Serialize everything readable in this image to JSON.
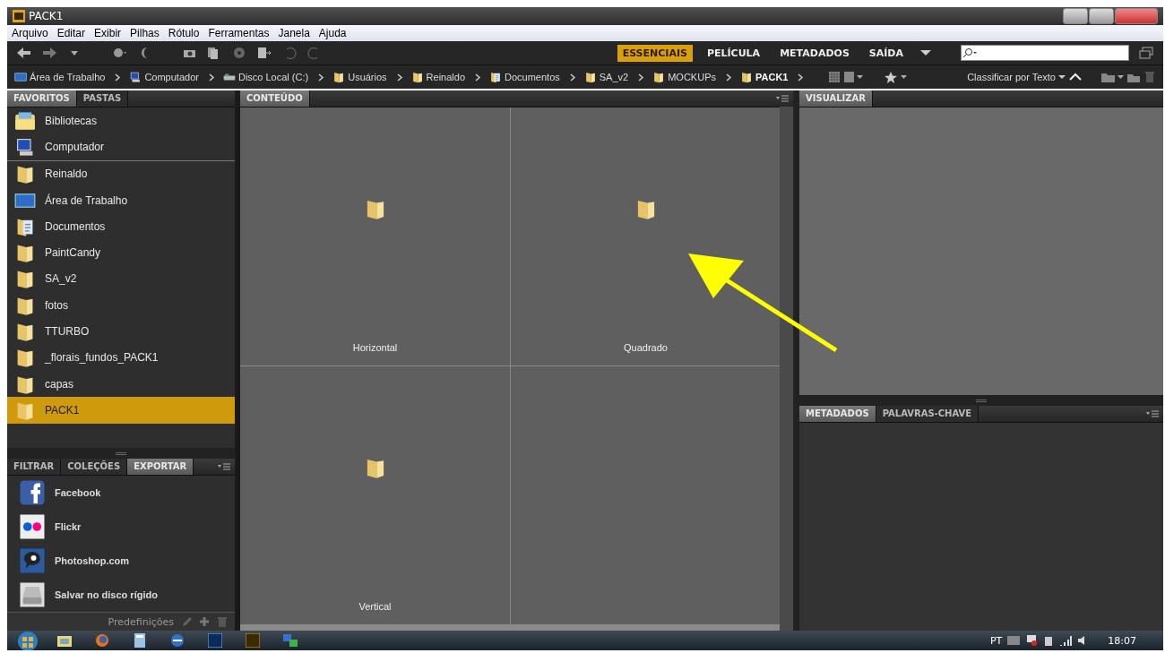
{
  "window": {
    "title": "PACK1"
  },
  "menu": [
    "Arquivo",
    "Editar",
    "Exibir",
    "Pilhas",
    "Rótulo",
    "Ferramentas",
    "Janela",
    "Ajuda"
  ],
  "workspaces": [
    {
      "label": "ESSENCIAIS",
      "selected": true
    },
    {
      "label": "PELÍCULA",
      "selected": false
    },
    {
      "label": "METADADOS",
      "selected": false
    },
    {
      "label": "SAÍDA",
      "selected": false
    }
  ],
  "breadcrumb": [
    {
      "label": "Área de Trabalho",
      "kind": "desktop",
      "current": false
    },
    {
      "label": "Computador",
      "kind": "computer",
      "current": false
    },
    {
      "label": "Disco Local (C:)",
      "kind": "drive",
      "current": false
    },
    {
      "label": "Usuários",
      "kind": "folder",
      "current": false
    },
    {
      "label": "Reinaldo",
      "kind": "folder",
      "current": false
    },
    {
      "label": "Documentos",
      "kind": "documents",
      "current": false
    },
    {
      "label": "SA_v2",
      "kind": "folder",
      "current": false
    },
    {
      "label": "MOCKUPs",
      "kind": "folder",
      "current": false
    },
    {
      "label": "PACK1",
      "kind": "folder",
      "current": true
    }
  ],
  "sort": {
    "label": "Classificar por Texto"
  },
  "favorites_panel": {
    "tabs": [
      {
        "label": "FAVORITOS",
        "selected": true
      },
      {
        "label": "PASTAS",
        "selected": false
      }
    ],
    "system_items": [
      {
        "label": "Bibliotecas",
        "kind": "library",
        "selected": false
      },
      {
        "label": "Computador",
        "kind": "computer",
        "selected": false
      }
    ],
    "items": [
      {
        "label": "Reinaldo",
        "kind": "folder",
        "selected": false
      },
      {
        "label": "Área de Trabalho",
        "kind": "desktop",
        "selected": false
      },
      {
        "label": "Documentos",
        "kind": "documents",
        "selected": false
      },
      {
        "label": "PaintCandy",
        "kind": "folder",
        "selected": false
      },
      {
        "label": "SA_v2",
        "kind": "folder",
        "selected": false
      },
      {
        "label": "fotos",
        "kind": "folder",
        "selected": false
      },
      {
        "label": "TTURBO",
        "kind": "folder",
        "selected": false
      },
      {
        "label": "_florais_fundos_PACK1",
        "kind": "folder",
        "selected": false
      },
      {
        "label": "capas",
        "kind": "folder",
        "selected": false
      },
      {
        "label": "PACK1",
        "kind": "folder",
        "selected": true
      }
    ]
  },
  "export_panel": {
    "tabs": [
      {
        "label": "FILTRAR",
        "selected": false
      },
      {
        "label": "COLEÇÕES",
        "selected": false
      },
      {
        "label": "EXPORTAR",
        "selected": true
      }
    ],
    "items": [
      {
        "label": "Facebook",
        "kind": "facebook"
      },
      {
        "label": "Flickr",
        "kind": "flickr"
      },
      {
        "label": "Photoshop.com",
        "kind": "photoshop"
      },
      {
        "label": "Salvar no disco rígido",
        "kind": "disk"
      }
    ],
    "footer": "Predefinições"
  },
  "content_panel": {
    "tab": "CONTEÚDO",
    "items": [
      {
        "label": "Horizontal"
      },
      {
        "label": "Quadrado"
      },
      {
        "label": "Vertical"
      }
    ]
  },
  "preview_panel": {
    "tab": "VISUALIZAR"
  },
  "metadata_panel": {
    "tabs": [
      {
        "label": "METADADOS",
        "selected": true
      },
      {
        "label": "PALAVRAS-CHAVE",
        "selected": false
      }
    ]
  },
  "annotations": [
    {
      "kind": "arrow"
    }
  ],
  "taskbar": {
    "apps": [
      {
        "kind": "explorer"
      },
      {
        "kind": "browser"
      },
      {
        "kind": "calculator"
      },
      {
        "kind": "mail"
      },
      {
        "kind": "photoshop"
      },
      {
        "kind": "bridge"
      },
      {
        "kind": "network"
      }
    ],
    "language": "PT",
    "clock": "18:07"
  }
}
